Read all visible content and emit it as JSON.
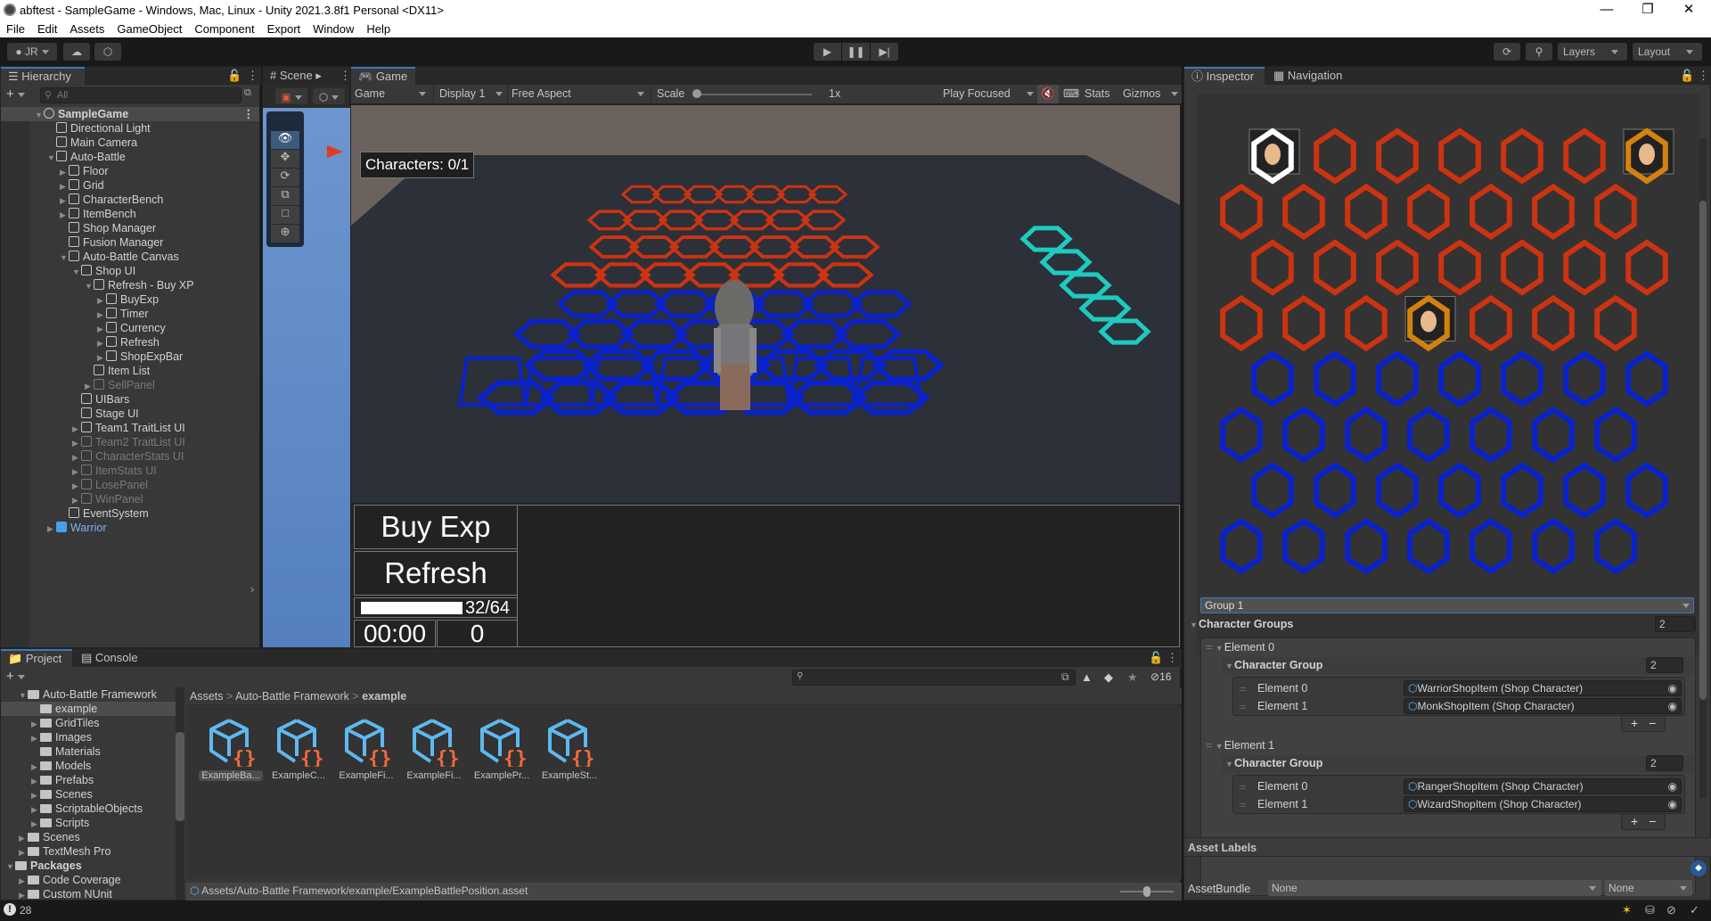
{
  "window": {
    "title": "abftest - SampleGame - Windows, Mac, Linux - Unity 2021.3.8f1 Personal <DX11>",
    "controls": [
      "minimize",
      "maximize",
      "close"
    ]
  },
  "menu": [
    "File",
    "Edit",
    "Assets",
    "GameObject",
    "Component",
    "Export",
    "Window",
    "Help"
  ],
  "toolbar": {
    "account": "JR",
    "layers": "Layers",
    "layout": "Layout",
    "play_icons": [
      "play-icon",
      "pause-icon",
      "step-icon"
    ]
  },
  "hierarchy": {
    "tab": "Hierarchy",
    "search_placeholder": "All",
    "items": [
      {
        "label": "SampleGame",
        "depth": 0,
        "expander": "open",
        "style": "scene"
      },
      {
        "label": "Directional Light",
        "depth": 1,
        "expander": "none",
        "style": "normal"
      },
      {
        "label": "Main Camera",
        "depth": 1,
        "expander": "none",
        "style": "normal"
      },
      {
        "label": "Auto-Battle",
        "depth": 1,
        "expander": "open",
        "style": "normal"
      },
      {
        "label": "Floor",
        "depth": 2,
        "expander": "closed",
        "style": "normal"
      },
      {
        "label": "Grid",
        "depth": 2,
        "expander": "closed",
        "style": "normal"
      },
      {
        "label": "CharacterBench",
        "depth": 2,
        "expander": "closed",
        "style": "normal"
      },
      {
        "label": "ItemBench",
        "depth": 2,
        "expander": "closed",
        "style": "normal"
      },
      {
        "label": "Shop Manager",
        "depth": 2,
        "expander": "none",
        "style": "normal"
      },
      {
        "label": "Fusion Manager",
        "depth": 2,
        "expander": "none",
        "style": "normal"
      },
      {
        "label": "Auto-Battle Canvas",
        "depth": 2,
        "expander": "open",
        "style": "normal"
      },
      {
        "label": "Shop UI",
        "depth": 3,
        "expander": "open",
        "style": "normal"
      },
      {
        "label": "Refresh - Buy XP",
        "depth": 4,
        "expander": "open",
        "style": "normal"
      },
      {
        "label": "BuyExp",
        "depth": 5,
        "expander": "closed",
        "style": "normal"
      },
      {
        "label": "Timer",
        "depth": 5,
        "expander": "closed",
        "style": "normal"
      },
      {
        "label": "Currency",
        "depth": 5,
        "expander": "closed",
        "style": "normal"
      },
      {
        "label": "Refresh",
        "depth": 5,
        "expander": "closed",
        "style": "normal"
      },
      {
        "label": "ShopExpBar",
        "depth": 5,
        "expander": "closed",
        "style": "normal"
      },
      {
        "label": "Item List",
        "depth": 4,
        "expander": "none",
        "style": "normal"
      },
      {
        "label": "SellPanel",
        "depth": 4,
        "expander": "closed",
        "style": "dim"
      },
      {
        "label": "UIBars",
        "depth": 3,
        "expander": "none",
        "style": "normal"
      },
      {
        "label": "Stage UI",
        "depth": 3,
        "expander": "none",
        "style": "normal"
      },
      {
        "label": "Team1 TraitList UI",
        "depth": 3,
        "expander": "closed",
        "style": "normal"
      },
      {
        "label": "Team2 TraitList UI",
        "depth": 3,
        "expander": "closed",
        "style": "dim"
      },
      {
        "label": "CharacterStats UI",
        "depth": 3,
        "expander": "closed",
        "style": "dim"
      },
      {
        "label": "ItemStats UI",
        "depth": 3,
        "expander": "closed",
        "style": "dim"
      },
      {
        "label": "LosePanel",
        "depth": 3,
        "expander": "closed",
        "style": "dim"
      },
      {
        "label": "WinPanel",
        "depth": 3,
        "expander": "closed",
        "style": "dim"
      },
      {
        "label": "EventSystem",
        "depth": 2,
        "expander": "none",
        "style": "normal"
      },
      {
        "label": "Warrior",
        "depth": 1,
        "expander": "closed",
        "style": "blue"
      }
    ]
  },
  "scene": {
    "tab": "Scene"
  },
  "game": {
    "tab": "Game",
    "mode": "Game",
    "display": "Display 1",
    "aspect": "Free Aspect",
    "scale_label": "Scale",
    "scale_value": "1x",
    "play_mode": "Play Focused",
    "stats": "Stats",
    "gizmos": "Gizmos",
    "characters_label": "Characters: 0/1",
    "buy_exp": "Buy Exp",
    "refresh": "Refresh",
    "exp_text": "32/64",
    "exp_progress": 0.5,
    "timer": "00:00",
    "currency": "0",
    "colors": {
      "enemy_hex": "#cc3311",
      "player_hex": "#0a22cc",
      "bench_hex": "#1ecbbf",
      "sky": "#6b625e",
      "floor": "#2a2f38"
    }
  },
  "inspector": {
    "tabs": [
      "Inspector",
      "Navigation"
    ],
    "grid": {
      "rows": 8,
      "cols": 7,
      "enemy_rows": 4,
      "colors": {
        "enemy": "#cc3311",
        "player": "#0a22cc",
        "selected": "#ffffff",
        "occupied": "#d4820e"
      }
    },
    "group_select": "Group 1",
    "character_groups_label": "Character Groups",
    "character_groups_count": "2",
    "elements": [
      {
        "label": "Element 0",
        "group_label": "Character Group",
        "count": "2",
        "items": [
          {
            "label": "Element 0",
            "value": "WarriorShopItem (Shop Character)"
          },
          {
            "label": "Element 1",
            "value": "MonkShopItem (Shop Character)"
          }
        ]
      },
      {
        "label": "Element 1",
        "group_label": "Character Group",
        "count": "2",
        "items": [
          {
            "label": "Element 0",
            "value": "RangerShopItem (Shop Character)"
          },
          {
            "label": "Element 1",
            "value": "WizardShopItem (Shop Character)"
          }
        ]
      }
    ],
    "asset_labels": "Asset Labels",
    "asset_bundle_label": "AssetBundle",
    "asset_bundle_value": "None",
    "asset_bundle_variant": "None"
  },
  "project": {
    "tabs": [
      "Project",
      "Console"
    ],
    "hidden_count": "16",
    "tree": [
      {
        "label": "Auto-Battle Framework",
        "depth": 1,
        "expander": "open",
        "selected": false
      },
      {
        "label": "example",
        "depth": 2,
        "expander": "none",
        "selected": true
      },
      {
        "label": "GridTiles",
        "depth": 2,
        "expander": "closed",
        "selected": false
      },
      {
        "label": "Images",
        "depth": 2,
        "expander": "closed",
        "selected": false
      },
      {
        "label": "Materials",
        "depth": 2,
        "expander": "none",
        "selected": false
      },
      {
        "label": "Models",
        "depth": 2,
        "expander": "closed",
        "selected": false
      },
      {
        "label": "Prefabs",
        "depth": 2,
        "expander": "closed",
        "selected": false
      },
      {
        "label": "Scenes",
        "depth": 2,
        "expander": "closed",
        "selected": false
      },
      {
        "label": "ScriptableObjects",
        "depth": 2,
        "expander": "closed",
        "selected": false
      },
      {
        "label": "Scripts",
        "depth": 2,
        "expander": "closed",
        "selected": false
      },
      {
        "label": "Scenes",
        "depth": 1,
        "expander": "closed",
        "selected": false
      },
      {
        "label": "TextMesh Pro",
        "depth": 1,
        "expander": "closed",
        "selected": false
      },
      {
        "label": "Packages",
        "depth": 0,
        "expander": "open",
        "selected": false
      },
      {
        "label": "Code Coverage",
        "depth": 1,
        "expander": "closed",
        "selected": false
      },
      {
        "label": "Custom NUnit",
        "depth": 1,
        "expander": "closed",
        "selected": false
      }
    ],
    "breadcrumb": [
      "Assets",
      "Auto-Battle Framework",
      "example"
    ],
    "assets": [
      "ExampleBa...",
      "ExampleC...",
      "ExampleFi...",
      "ExampleFi...",
      "ExamplePr...",
      "ExampleSt..."
    ],
    "selected_asset_index": 0,
    "footer_path": "Assets/Auto-Battle Framework/example/ExampleBattlePosition.asset"
  },
  "statusbar": {
    "count": "28"
  }
}
